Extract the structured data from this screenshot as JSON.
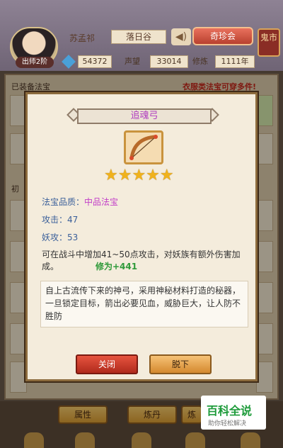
{
  "header": {
    "player_name": "苏孟祁",
    "stage_badge": "出师2阶",
    "location": "落日谷",
    "treasure_button": "奇珍会",
    "ghost_market": "鬼市",
    "currency_value": "54372",
    "prestige_label": "声望",
    "prestige_value": "33014",
    "cultivation_label": "修炼",
    "cultivation_value": "1111年"
  },
  "inventory": {
    "equipped_label": "已装备法宝",
    "equip_warning": "衣服类法宝可穿多件!",
    "initial_label": "初"
  },
  "dialog": {
    "title": "追魂弓",
    "stars": "★★★★★",
    "quality_label": "法宝品质：",
    "quality_value": "中品法宝",
    "attack_label": "攻击：",
    "attack_value": "47",
    "demon_attack_label": "妖攻：",
    "demon_attack_value": "53",
    "effect_text": "可在战斗中增加41~50点攻击，对妖族有额外伤害加成。",
    "cultivation_bonus": "修为+441",
    "description": "自上古流传下来的神弓，采用神秘材料打造的秘器，一旦锁定目标，箭出必要见血，威胁巨大，让人防不胜防",
    "close_button": "关闭",
    "remove_button": "脱下"
  },
  "bottom": {
    "tab_attributes": "属性",
    "tab_alchemy": "炼丹",
    "tab_third": "炼"
  },
  "watermark": {
    "title": "百科全说",
    "subtitle": "助你轻松解决"
  },
  "colors": {
    "title_purple": "#b03ec0",
    "quality_magenta": "#c23ec8",
    "stat_blue": "#3a5f9a",
    "bonus_green": "#2f9a3a",
    "warning_red": "#c2261a",
    "close_red": "#b02a1c",
    "star_gold": "#f0b21c"
  },
  "icons": [
    "sound-icon",
    "bow-icon",
    "star-icon",
    "gem-icon"
  ]
}
